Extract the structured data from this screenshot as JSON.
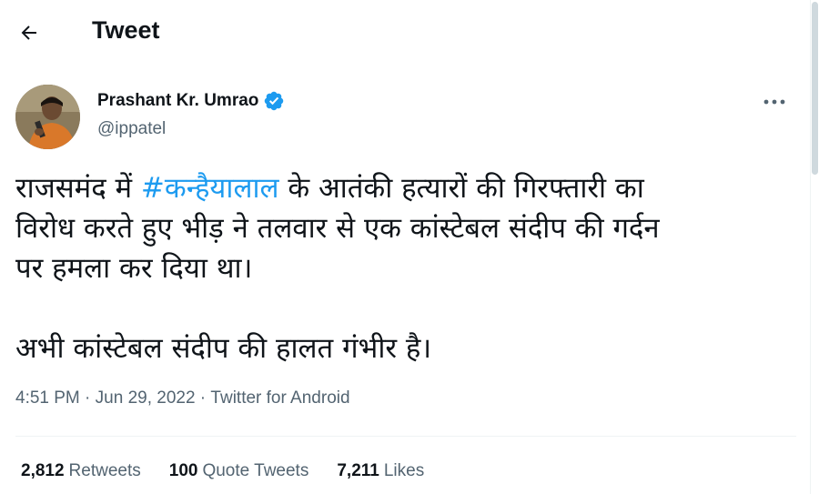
{
  "header": {
    "title": "Tweet",
    "back_icon": "arrow-left-icon"
  },
  "author": {
    "name": "Prashant Kr. Umrao",
    "handle": "@ippatel",
    "verified": true,
    "verified_color": "#1d9bf0"
  },
  "tweet": {
    "line1_before": "राजसमंद में ",
    "hashtag": "#कन्हैयालाल",
    "line1_after": " के आतंकी हत्यारों की गिरफ्तारी का",
    "line2": "विरोध करते हुए भीड़ ने तलवार से एक कांस्टेबल संदीप की गर्दन",
    "line3": "पर हमला कर दिया था।",
    "line4": "",
    "line5": "अभी कांस्टेबल संदीप की हालत गंभीर है।"
  },
  "meta": {
    "time": "4:51 PM",
    "separator": " · ",
    "date": "Jun 29, 2022",
    "source": "Twitter for Android"
  },
  "stats": {
    "retweets_count": "2,812",
    "retweets_label": "Retweets",
    "quotes_count": "100",
    "quotes_label": "Quote Tweets",
    "likes_count": "7,211",
    "likes_label": "Likes"
  },
  "colors": {
    "text_primary": "#0f1419",
    "text_secondary": "#536471",
    "accent": "#1d9bf0",
    "divider": "#eff3f4"
  }
}
